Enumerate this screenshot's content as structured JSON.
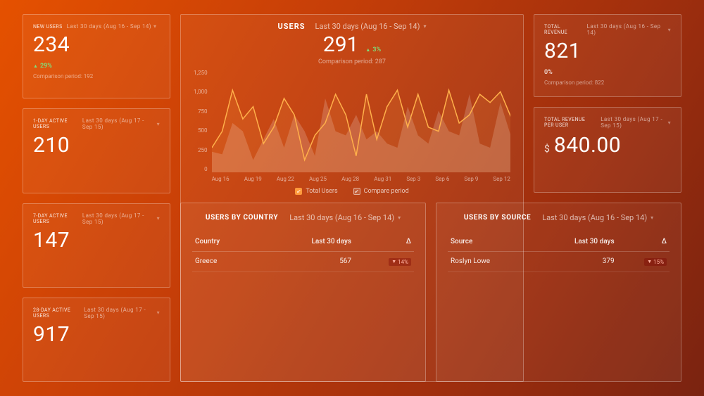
{
  "left": {
    "new_users": {
      "label": "NEW USERS",
      "range": "Last 30 days (Aug 16 - Sep 14)",
      "value": "234",
      "delta": "29%",
      "compare": "Comparison period: 192"
    },
    "day1": {
      "label": "1-DAY ACTIVE USERS",
      "range": "Last 30 days (Aug 17 - Sep 15)",
      "value": "210"
    },
    "day7": {
      "label": "7-DAY ACTIVE USERS",
      "range": "Last 30 days (Aug 17 - Sep 15)",
      "value": "147"
    },
    "day28": {
      "label": "28-DAY ACTIVE USERS",
      "range": "Last 30 days (Aug 17 - Sep 15)",
      "value": "917"
    }
  },
  "center": {
    "title": "USERS",
    "range": "Last 30 days (Aug 16 - Sep 14)",
    "value": "291",
    "delta": "3%",
    "compare": "Comparison period: 287",
    "legend_primary": "Total Users",
    "legend_compare": "Compare period"
  },
  "right": {
    "total_revenue": {
      "label": "TOTAL REVENUE",
      "range": "Last 30 days (Aug 16 - Sep 14)",
      "value": "821",
      "delta": "0%",
      "compare": "Comparison period: 822"
    },
    "revenue_per_user": {
      "label": "TOTAL REVENUE PER USER",
      "range": "Last 30 days (Aug 17 - Sep 15)",
      "currency": "$",
      "value": "840.00"
    }
  },
  "tables": {
    "country": {
      "title": "USERS BY COUNTRY",
      "range": "Last 30 days (Aug 16 - Sep 14)",
      "col1": "Country",
      "col2": "Last 30 days",
      "col3": "Δ",
      "row_name": "Greece",
      "row_value": "567",
      "row_delta": "14%"
    },
    "source": {
      "title": "USERS BY SOURCE",
      "range": "Last 30 days (Aug 16 - Sep 14)",
      "col1": "Source",
      "col2": "Last 30 days",
      "col3": "Δ",
      "row_name": "Roslyn Lowe",
      "row_value": "379",
      "row_delta": "15%"
    }
  },
  "chart_data": {
    "type": "line",
    "title": "Users — Last 30 days",
    "xlabel": "",
    "ylabel": "",
    "ylim": [
      0,
      1250
    ],
    "y_ticks": [
      "1,250",
      "1,000",
      "750",
      "500",
      "250",
      "0"
    ],
    "x_ticks": [
      "Aug 16",
      "Aug 19",
      "Aug 22",
      "Aug 25",
      "Aug 28",
      "Aug 31",
      "Sep 3",
      "Sep 6",
      "Sep 9",
      "Sep 12"
    ],
    "series": [
      {
        "name": "Total Users",
        "values": [
          300,
          500,
          1000,
          650,
          800,
          350,
          550,
          900,
          700,
          150,
          450,
          600,
          950,
          700,
          200,
          950,
          400,
          800,
          1000,
          550,
          950,
          550,
          500,
          1000,
          600,
          700,
          950,
          850,
          980,
          680
        ]
      },
      {
        "name": "Compare period",
        "values": [
          250,
          220,
          600,
          500,
          150,
          400,
          650,
          300,
          700,
          500,
          200,
          900,
          500,
          450,
          700,
          400,
          500,
          350,
          300,
          800,
          450,
          350,
          750,
          500,
          450,
          950,
          350,
          300,
          850,
          450
        ]
      }
    ]
  }
}
